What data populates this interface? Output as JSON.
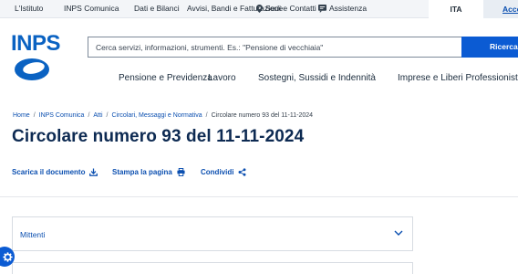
{
  "topbar": {
    "links": [
      "L'Istituto",
      "INPS Comunica",
      "Dati e Bilanci",
      "Avvisi, Bandi e Fatturazione",
      "Sedi e Contatti",
      "Assistenza"
    ],
    "language": "ITA",
    "login": "Accedi"
  },
  "header": {
    "logo_text": "INPS",
    "search_placeholder": "Cerca servizi, informazioni, strumenti. Es.: \"Pensione di vecchiaia\"",
    "search_button": "Ricerca"
  },
  "nav": {
    "items": [
      "Pensione e Previdenza",
      "Lavoro",
      "Sostegni, Sussidi e Indennità",
      "Imprese e Liberi Professionisti"
    ]
  },
  "breadcrumb": {
    "items": [
      "Home",
      "INPS Comunica",
      "Atti",
      "Circolari, Messaggi e Normativa"
    ],
    "current": "Circolare numero 93 del 11-11-2024"
  },
  "page": {
    "title": "Circolare numero 93 del 11-11-2024"
  },
  "actions": {
    "download": "Scarica il documento",
    "print": "Stampa la pagina",
    "share": "Condividi"
  },
  "accordion": {
    "label": "Mittenti"
  },
  "colors": {
    "brand_blue": "#0b5bd3",
    "link_blue": "#0b4fb0",
    "title_navy": "#0d2a52"
  }
}
